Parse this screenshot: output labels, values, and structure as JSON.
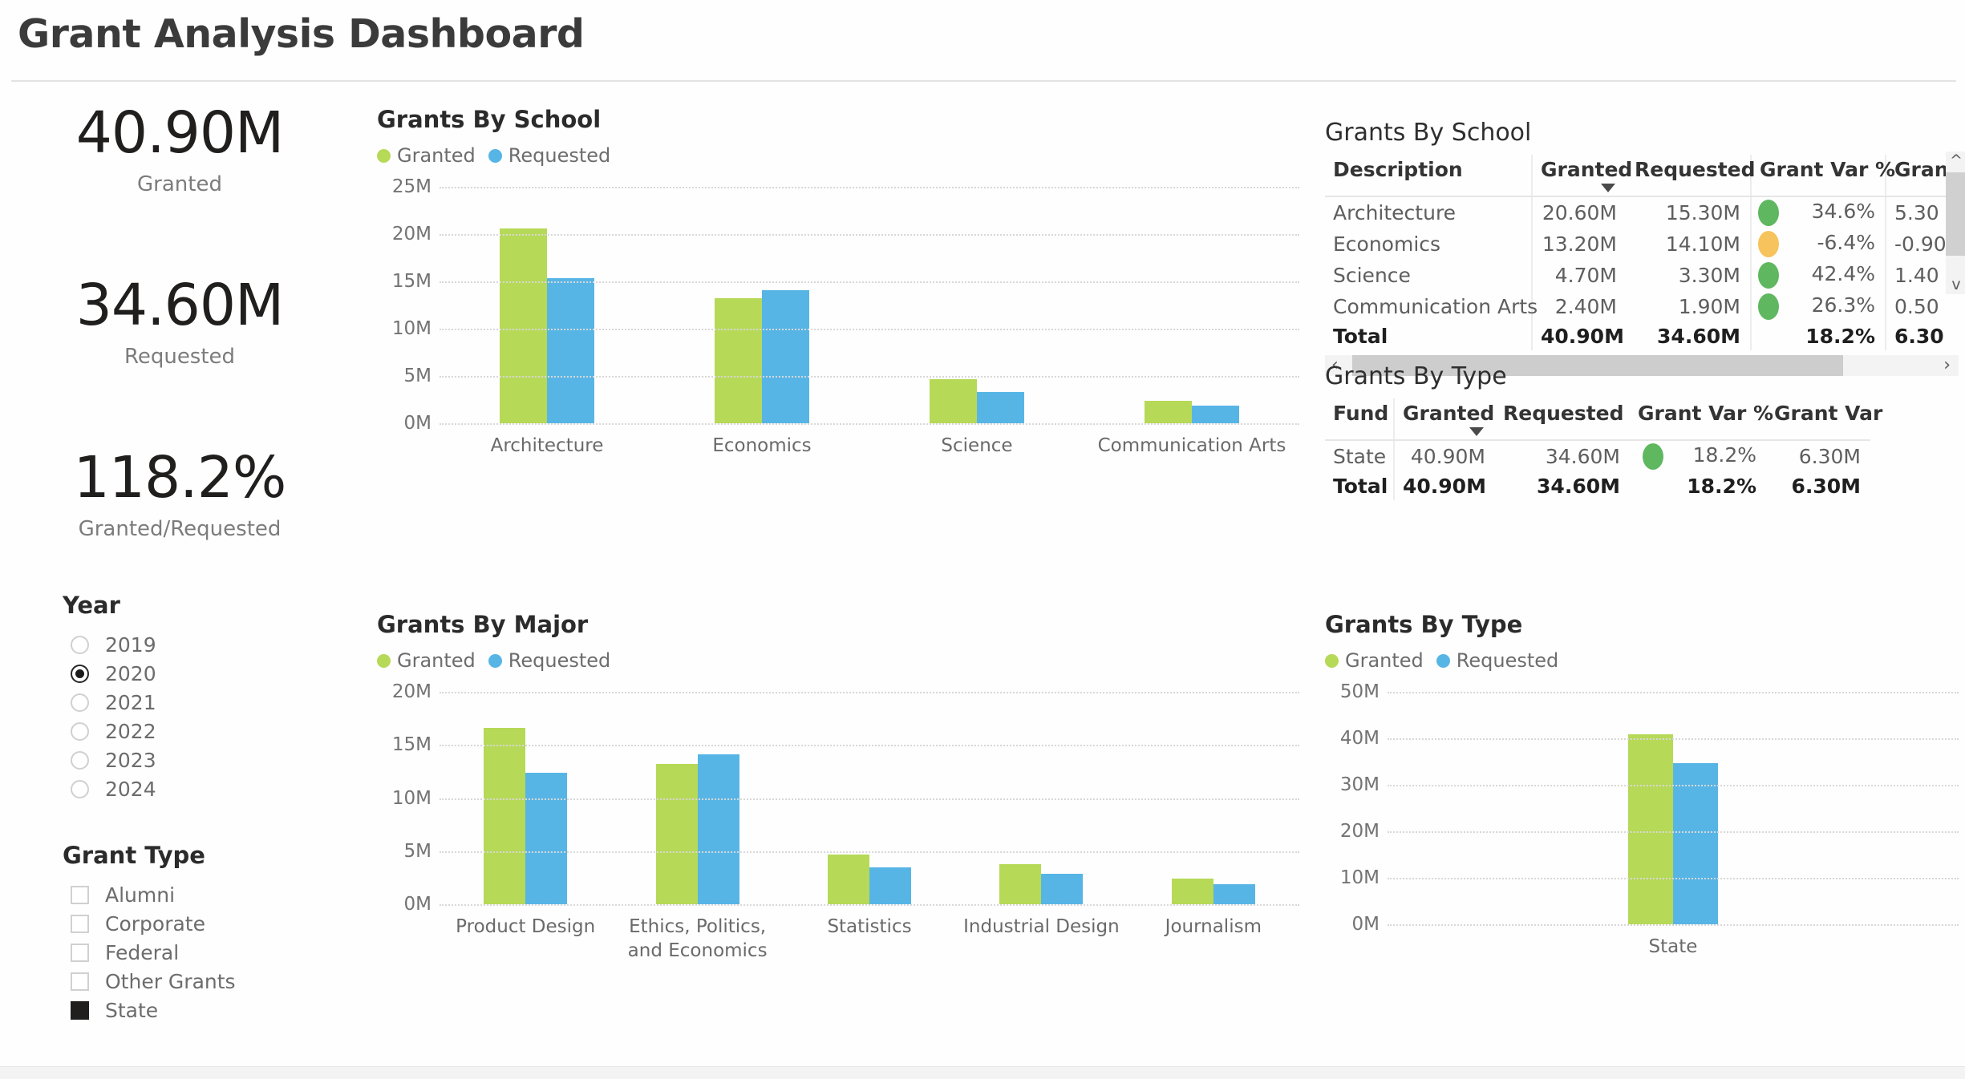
{
  "header": {
    "title": "Grant Analysis Dashboard"
  },
  "kpis": [
    {
      "value": "40.90M",
      "label": "Granted"
    },
    {
      "value": "34.60M",
      "label": "Requested"
    },
    {
      "value": "118.2%",
      "label": "Granted/Requested"
    }
  ],
  "slicers": {
    "year": {
      "title": "Year",
      "type": "radio",
      "options": [
        {
          "label": "2019",
          "selected": false
        },
        {
          "label": "2020",
          "selected": true
        },
        {
          "label": "2021",
          "selected": false
        },
        {
          "label": "2022",
          "selected": false
        },
        {
          "label": "2023",
          "selected": false
        },
        {
          "label": "2024",
          "selected": false
        }
      ]
    },
    "grant_type": {
      "title": "Grant Type",
      "type": "checkbox",
      "options": [
        {
          "label": "Alumni",
          "selected": false
        },
        {
          "label": "Corporate",
          "selected": false
        },
        {
          "label": "Federal",
          "selected": false
        },
        {
          "label": "Other Grants",
          "selected": false
        },
        {
          "label": "State",
          "selected": true
        }
      ]
    }
  },
  "colors": {
    "granted": "#b6d957",
    "requested": "#57b5e6",
    "status_good": "#5fb760",
    "status_warn": "#f7c35c"
  },
  "tables": {
    "grants_by_school": {
      "title": "Grants By School",
      "columns": [
        "Description",
        "Granted",
        "Requested",
        "Grant Var %",
        "Grant"
      ],
      "sorted_column": "Granted",
      "rows": [
        {
          "description": "Architecture",
          "granted": "20.60M",
          "requested": "15.30M",
          "status": "good",
          "grant_var_pct": "34.6%",
          "grant_var": "5.30"
        },
        {
          "description": "Economics",
          "granted": "13.20M",
          "requested": "14.10M",
          "status": "warn",
          "grant_var_pct": "-6.4%",
          "grant_var": "-0.90"
        },
        {
          "description": "Science",
          "granted": "4.70M",
          "requested": "3.30M",
          "status": "good",
          "grant_var_pct": "42.4%",
          "grant_var": "1.40"
        },
        {
          "description": "Communication Arts",
          "granted": "2.40M",
          "requested": "1.90M",
          "status": "good",
          "grant_var_pct": "26.3%",
          "grant_var": "0.50"
        }
      ],
      "total": {
        "description": "Total",
        "granted": "40.90M",
        "requested": "34.60M",
        "status": "",
        "grant_var_pct": "18.2%",
        "grant_var": "6.30"
      }
    },
    "grants_by_type": {
      "title": "Grants By Type",
      "columns": [
        "Fund",
        "Granted",
        "Requested",
        "Grant Var %",
        "Grant Var"
      ],
      "sorted_column": "Granted",
      "rows": [
        {
          "fund": "State",
          "granted": "40.90M",
          "requested": "34.60M",
          "status": "good",
          "grant_var_pct": "18.2%",
          "grant_var": "6.30M"
        }
      ],
      "total": {
        "fund": "Total",
        "granted": "40.90M",
        "requested": "34.60M",
        "status": "",
        "grant_var_pct": "18.2%",
        "grant_var": "6.30M"
      }
    }
  },
  "chart_data": [
    {
      "id": "grants_by_school",
      "type": "bar",
      "title": "Grants By School",
      "categories": [
        "Architecture",
        "Economics",
        "Science",
        "Communication Arts"
      ],
      "series": [
        {
          "name": "Granted",
          "values": [
            20.6,
            13.2,
            4.7,
            2.4
          ],
          "color": "#b6d957"
        },
        {
          "name": "Requested",
          "values": [
            15.3,
            14.1,
            3.3,
            1.9
          ],
          "color": "#57b5e6"
        }
      ],
      "yticks": [
        "0M",
        "5M",
        "10M",
        "15M",
        "20M",
        "25M"
      ],
      "ytickvals": [
        0,
        5,
        10,
        15,
        20,
        25
      ],
      "ylim": [
        0,
        25
      ],
      "xlabel": "",
      "ylabel": "",
      "grid": true,
      "legend": [
        "Granted",
        "Requested"
      ],
      "legend_position": "top-left"
    },
    {
      "id": "grants_by_major",
      "type": "bar",
      "title": "Grants By Major",
      "categories": [
        "Product Design",
        "Ethics, Politics,\nand Economics",
        "Statistics",
        "Industrial Design",
        "Journalism"
      ],
      "series": [
        {
          "name": "Granted",
          "values": [
            16.6,
            13.2,
            4.7,
            3.8,
            2.4
          ],
          "color": "#b6d957"
        },
        {
          "name": "Requested",
          "values": [
            12.4,
            14.1,
            3.5,
            2.9,
            1.9
          ],
          "color": "#57b5e6"
        }
      ],
      "yticks": [
        "0M",
        "5M",
        "10M",
        "15M",
        "20M"
      ],
      "ytickvals": [
        0,
        5,
        10,
        15,
        20
      ],
      "ylim": [
        0,
        20
      ],
      "xlabel": "",
      "ylabel": "",
      "grid": true,
      "legend": [
        "Granted",
        "Requested"
      ],
      "legend_position": "top-left"
    },
    {
      "id": "grants_by_type_chart",
      "type": "bar",
      "title": "Grants By Type",
      "categories": [
        "State"
      ],
      "series": [
        {
          "name": "Granted",
          "values": [
            40.9
          ],
          "color": "#b6d957"
        },
        {
          "name": "Requested",
          "values": [
            34.6
          ],
          "color": "#57b5e6"
        }
      ],
      "yticks": [
        "0M",
        "10M",
        "20M",
        "30M",
        "40M",
        "50M"
      ],
      "ytickvals": [
        0,
        10,
        20,
        30,
        40,
        50
      ],
      "ylim": [
        0,
        50
      ],
      "xlabel": "",
      "ylabel": "",
      "grid": true,
      "legend": [
        "Granted",
        "Requested"
      ],
      "legend_position": "top-left"
    }
  ]
}
